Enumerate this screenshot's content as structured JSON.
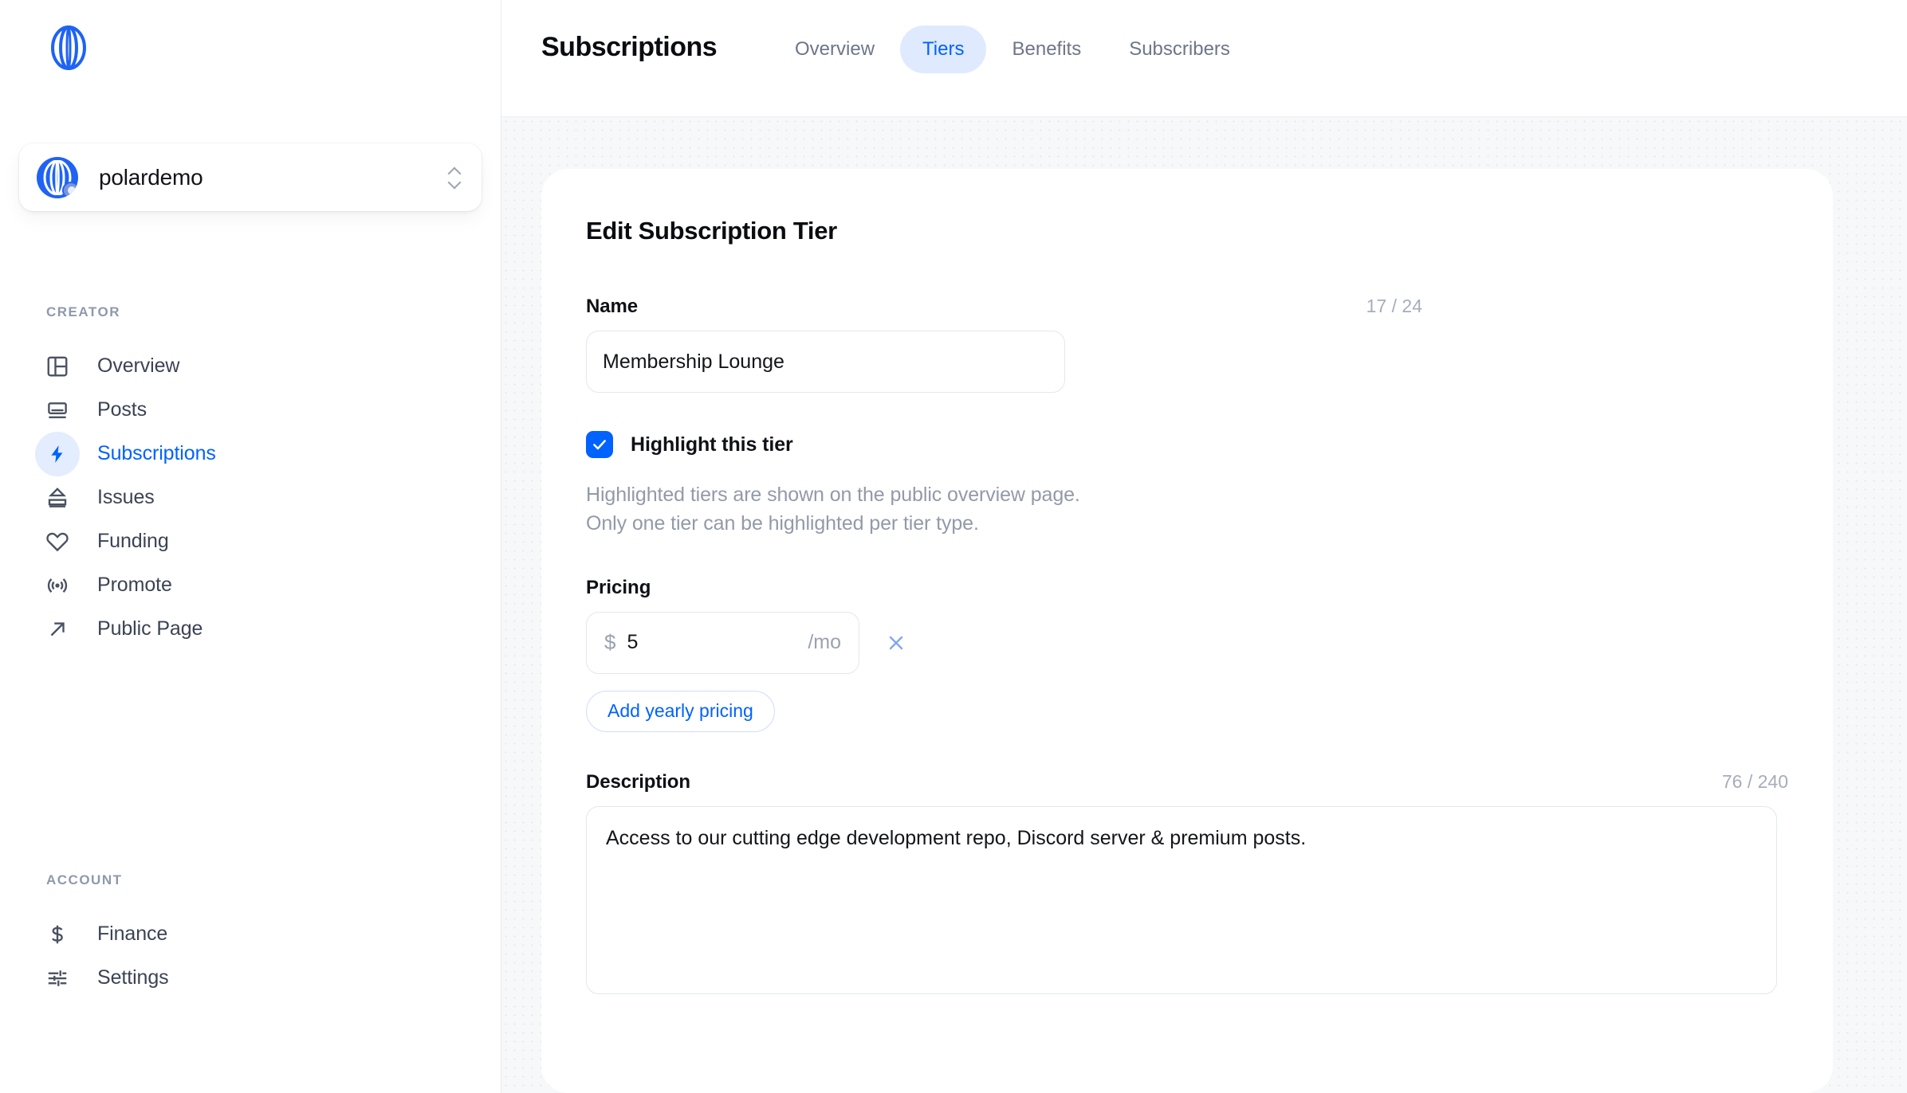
{
  "brand": {
    "logo_icon": "polar-logo-icon",
    "accent": "#0062ff"
  },
  "sidebar": {
    "org_switcher": {
      "name": "polardemo",
      "avatar_icon": "org-avatar-icon",
      "badge_icon": "github-badge-icon",
      "expand_icon": "chevron-up-down-icon"
    },
    "sections": [
      {
        "label": "CREATOR",
        "items": [
          {
            "label": "Overview",
            "icon": "layout-dashboard-icon",
            "active": false
          },
          {
            "label": "Posts",
            "icon": "posts-icon",
            "active": false
          },
          {
            "label": "Subscriptions",
            "icon": "lightning-bolt-icon",
            "active": true
          },
          {
            "label": "Issues",
            "icon": "issues-inbox-icon",
            "active": false
          },
          {
            "label": "Funding",
            "icon": "heart-icon",
            "active": false
          },
          {
            "label": "Promote",
            "icon": "broadcast-icon",
            "active": false
          },
          {
            "label": "Public Page",
            "icon": "arrow-up-right-icon",
            "active": false
          }
        ]
      },
      {
        "label": "ACCOUNT",
        "items": [
          {
            "label": "Finance",
            "icon": "dollar-sign-icon",
            "active": false
          },
          {
            "label": "Settings",
            "icon": "sliders-icon",
            "active": false
          }
        ]
      }
    ]
  },
  "header": {
    "title": "Subscriptions",
    "tabs": [
      {
        "label": "Overview",
        "active": false
      },
      {
        "label": "Tiers",
        "active": true
      },
      {
        "label": "Benefits",
        "active": false
      },
      {
        "label": "Subscribers",
        "active": false
      }
    ]
  },
  "form": {
    "title": "Edit Subscription Tier",
    "name": {
      "label": "Name",
      "counter": "17 / 24",
      "value": "Membership Lounge",
      "placeholder": "Name"
    },
    "highlight": {
      "checked": true,
      "check_icon": "checkmark-icon",
      "label": "Highlight this tier",
      "help_line_1": "Highlighted tiers are shown on the public overview page.",
      "help_line_2": "Only one tier can be highlighted per tier type."
    },
    "pricing": {
      "label": "Pricing",
      "currency_symbol": "$",
      "amount": "5",
      "amount_placeholder": "0",
      "interval": "/mo",
      "remove_icon": "close-x-icon",
      "add_yearly_label": "Add yearly pricing"
    },
    "description": {
      "label": "Description",
      "counter": "76 / 240",
      "value": "Access to our cutting edge development repo, Discord server & premium posts.",
      "placeholder": "Description"
    }
  }
}
